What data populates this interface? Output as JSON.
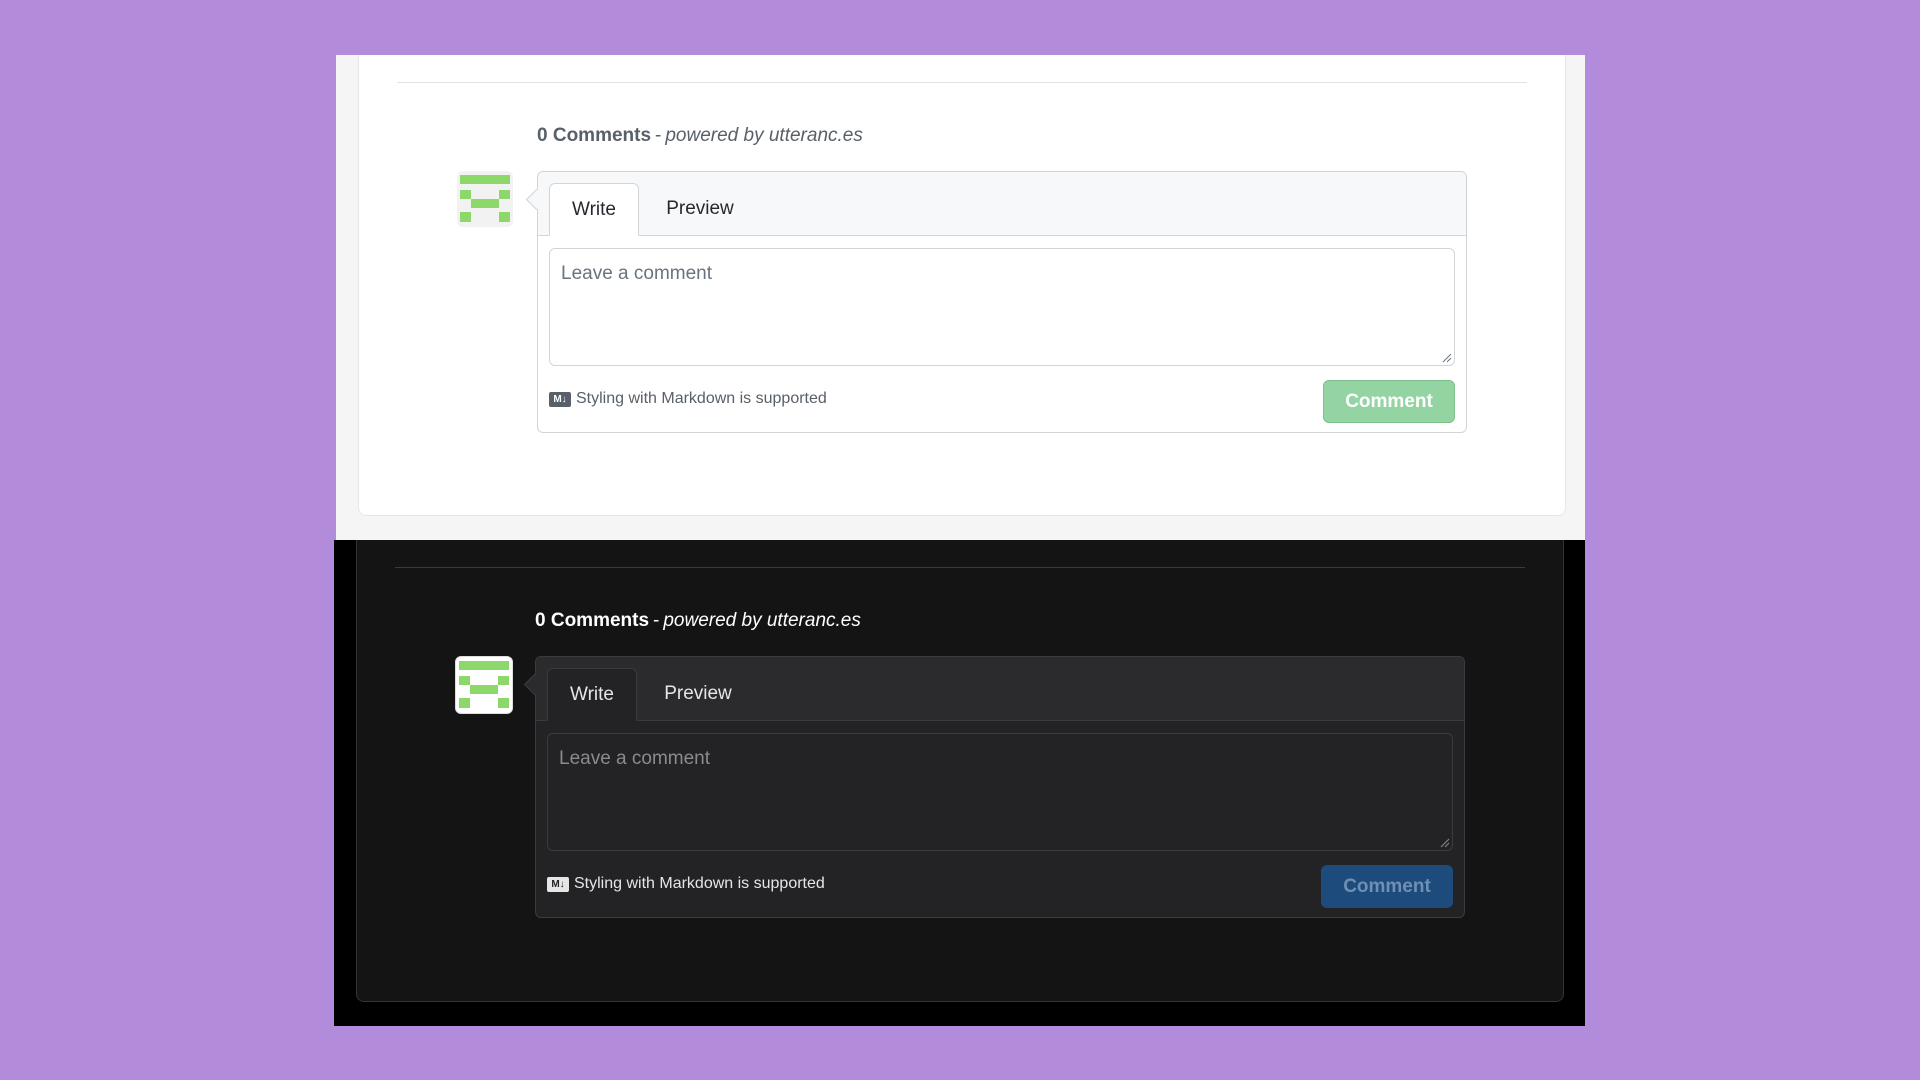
{
  "widget": {
    "comment_count": "0 Comments",
    "separator": "-",
    "powered_by": "powered by utteranc.es",
    "tabs": {
      "write": "Write",
      "preview": "Preview"
    },
    "textarea_placeholder": "Leave a comment",
    "markdown_badge": "M↓",
    "markdown_note": "Styling with Markdown is supported",
    "submit_label": "Comment"
  },
  "colors": {
    "background": "#b28bdb",
    "light_submit": "#94d3a2",
    "dark_submit": "#1d4b7c",
    "avatar_green": "#8cd86a"
  },
  "icons": {
    "avatar": "identicon-avatar",
    "markdown": "markdown-icon",
    "resize": "resize-grip-icon"
  }
}
